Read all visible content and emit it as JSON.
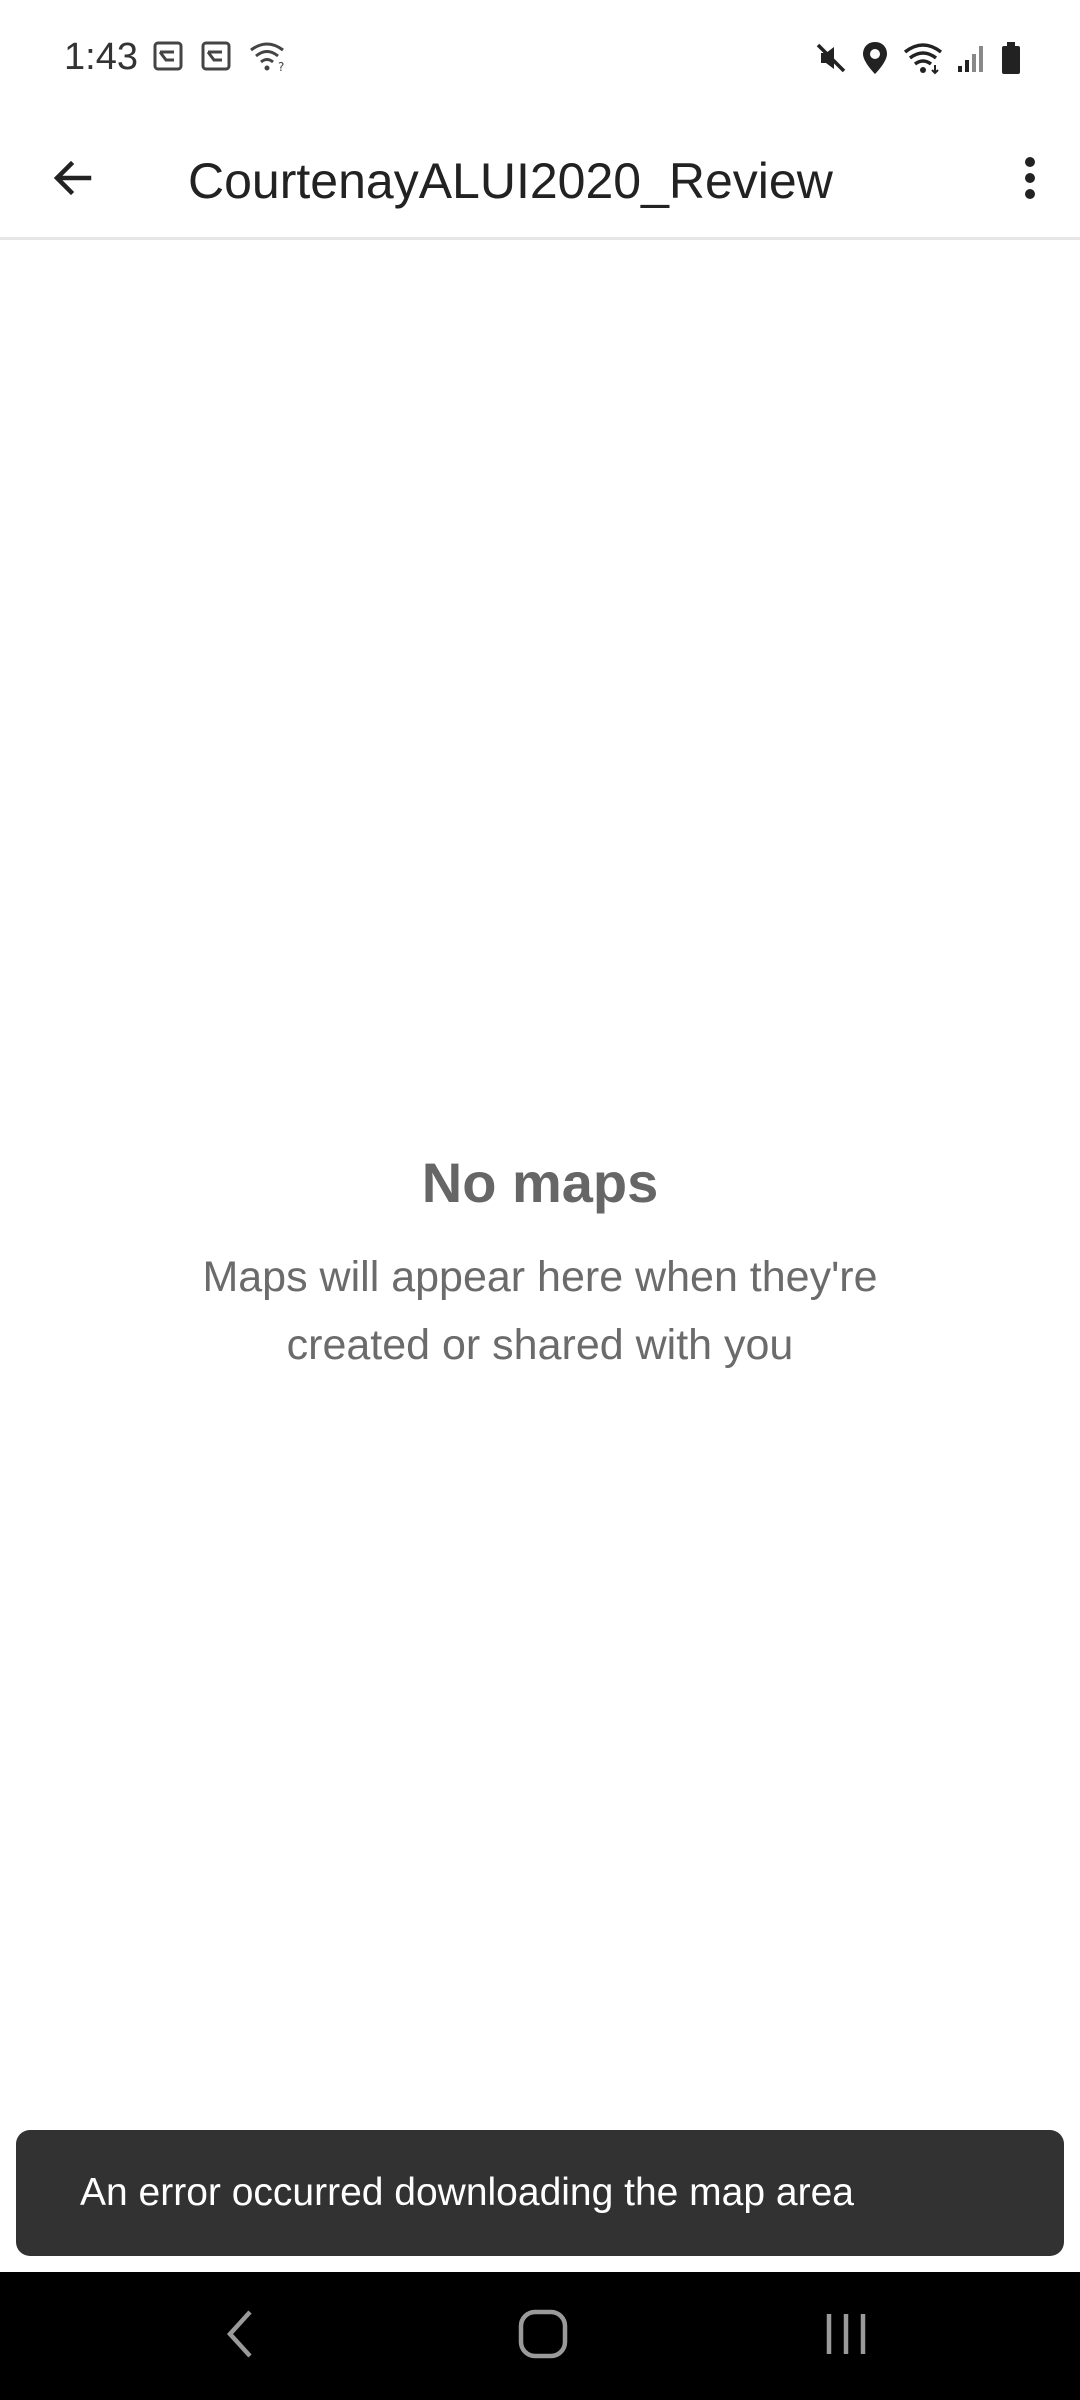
{
  "status_bar": {
    "time": "1:43",
    "left_icons": [
      "notification-icon",
      "notification-icon",
      "wifi-question-icon"
    ],
    "right_icons": [
      "mute-icon",
      "location-icon",
      "wifi-icon",
      "signal-icon",
      "battery-icon"
    ]
  },
  "app_bar": {
    "title": "CourtenayALUI2020_Review",
    "back_icon": "arrow-back-icon",
    "menu_icon": "more-vert-icon"
  },
  "empty_state": {
    "title": "No maps",
    "message": "Maps will appear here when they're created or shared with you"
  },
  "snackbar": {
    "message": "An error occurred downloading the map area"
  },
  "nav_bar": {
    "icons": [
      "nav-back-icon",
      "nav-home-icon",
      "nav-recents-icon"
    ]
  },
  "colors": {
    "background": "#ffffff",
    "title_text": "#222222",
    "empty_text": "#666666",
    "snackbar_bg": "#323232",
    "nav_bg": "#000000"
  }
}
